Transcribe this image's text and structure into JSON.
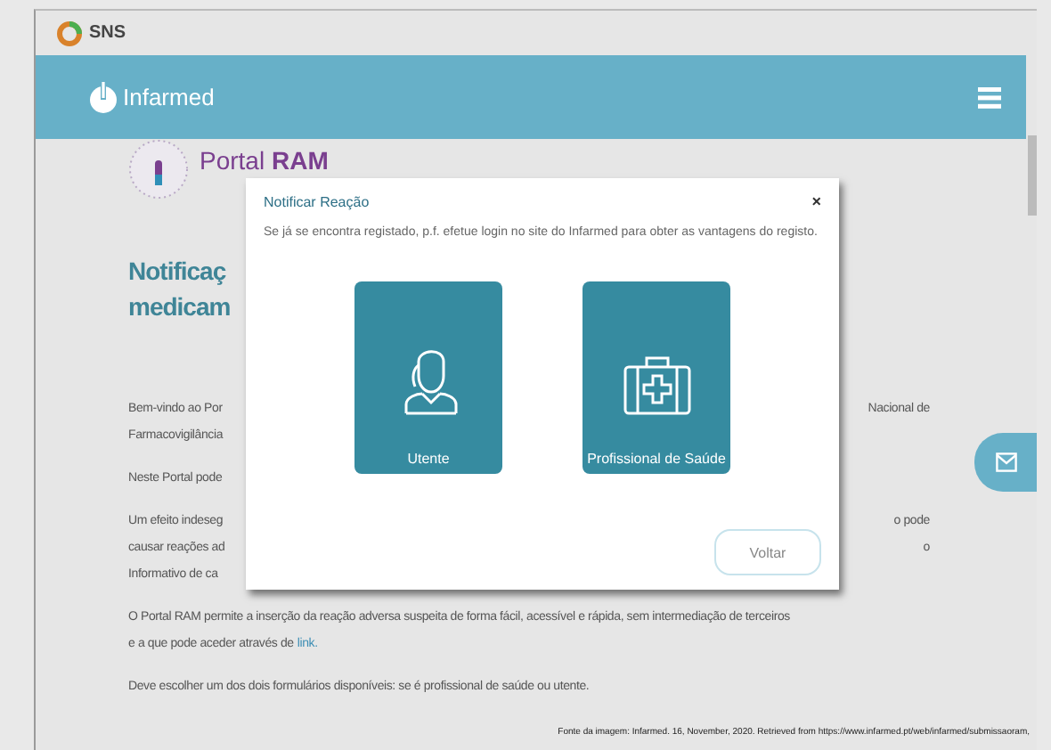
{
  "sns_bar": {
    "logo_text": "SNS"
  },
  "header": {
    "brand": "Infarmed"
  },
  "portal": {
    "name": "Portal",
    "name_bold": "RAM"
  },
  "title_lines": [
    "Notificaç",
    "medicam"
  ],
  "paragraphs": [
    {
      "lines": [
        {
          "left": "Bem-vindo ao Por",
          "right": "Nacional de"
        },
        {
          "left": "Farmacovigilância"
        }
      ]
    },
    {
      "lines": [
        {
          "left": "Neste Portal pode"
        }
      ]
    },
    {
      "lines": [
        {
          "left": "Um efeito indeseg",
          "right": "o pode"
        },
        {
          "left": "causar reações ad",
          "right": "o"
        },
        {
          "left": "Informativo de ca"
        }
      ]
    },
    {
      "lines": [
        {
          "left": "O Portal RAM permite a inserção da reação adversa suspeita de forma fácil, acessível e rápida, sem intermediação de terceiros"
        },
        {
          "left": "e a que pode aceder através de",
          "link": "link."
        }
      ]
    },
    {
      "lines": [
        {
          "left": "Deve escolher um dos dois formulários disponíveis: se é profissional de saúde ou utente."
        }
      ]
    }
  ],
  "modal": {
    "title": "Notificar Reação",
    "close": "×",
    "message": "Se já se encontra registado, p.f. efetue login no site do Infarmed para obter as vantagens do registo.",
    "options": [
      {
        "kind": "person",
        "label": "Utente"
      },
      {
        "kind": "medkit",
        "label": "Profissional de Saúde"
      }
    ],
    "back_button": "Voltar"
  },
  "caption": "Fonte da imagem: Infarmed. 16, November, 2020. Retrieved from https://www.infarmed.pt/web/infarmed/submissaoram,"
}
